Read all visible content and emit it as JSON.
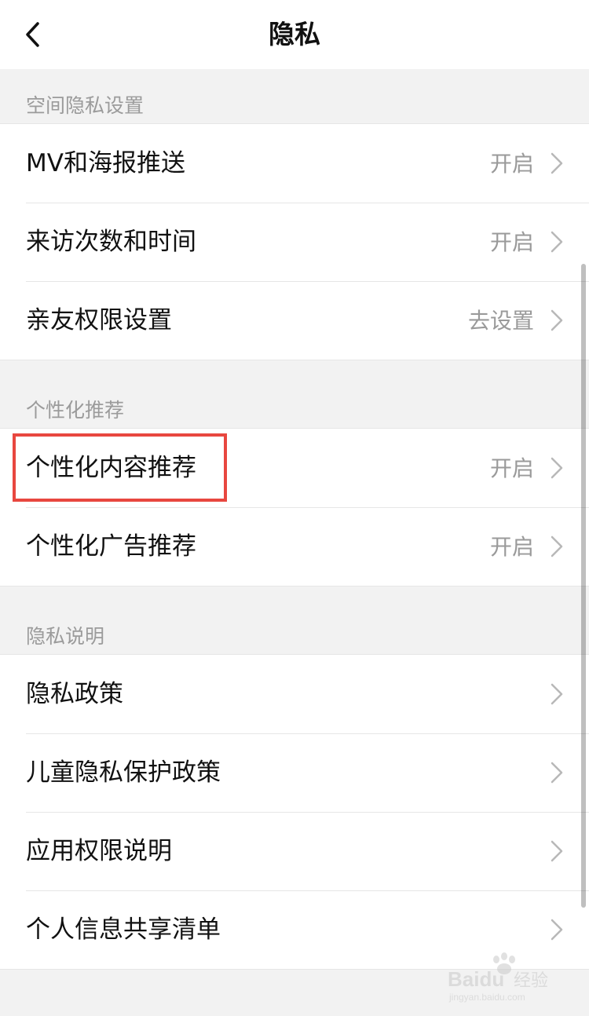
{
  "navbar": {
    "title": "隐私",
    "back_icon": "chevron-left-icon"
  },
  "sections": [
    {
      "header": "空间隐私设置",
      "items": [
        {
          "label": "MV和海报推送",
          "value": "开启"
        },
        {
          "label": "来访次数和时间",
          "value": "开启"
        },
        {
          "label": "亲友权限设置",
          "value": "去设置"
        }
      ]
    },
    {
      "header": "个性化推荐",
      "items": [
        {
          "label": "个性化内容推荐",
          "value": "开启",
          "highlighted": true
        },
        {
          "label": "个性化广告推荐",
          "value": "开启"
        }
      ]
    },
    {
      "header": "隐私说明",
      "items": [
        {
          "label": "隐私政策",
          "value": ""
        },
        {
          "label": "儿童隐私保护政策",
          "value": ""
        },
        {
          "label": "应用权限说明",
          "value": ""
        },
        {
          "label": "个人信息共享清单",
          "value": ""
        }
      ]
    }
  ],
  "colors": {
    "highlight_border": "#e8473f",
    "background": "#f2f2f2",
    "row_background": "#ffffff",
    "secondary_text": "#9a9a9a"
  },
  "watermark": {
    "icon": "baidu-paw-icon",
    "brand": "Baidu",
    "suffix": "经验",
    "url": "jingyan.baidu.com"
  }
}
